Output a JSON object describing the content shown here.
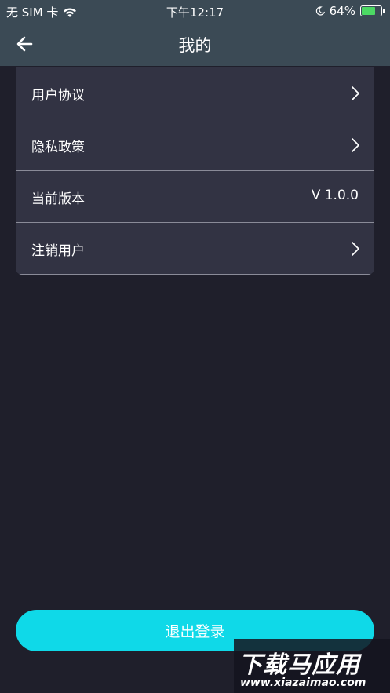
{
  "status_bar": {
    "carrier": "无 SIM 卡",
    "time": "下午12:17",
    "battery_percent": "64%",
    "battery_level": 0.64
  },
  "nav": {
    "title": "我的"
  },
  "settings": {
    "items": [
      {
        "label": "用户协议"
      },
      {
        "label": "隐私政策"
      },
      {
        "label": "当前版本",
        "value": "V 1.0.0"
      },
      {
        "label": "注销用户"
      }
    ]
  },
  "logout": {
    "label": "退出登录"
  },
  "watermark": {
    "title": "下载马应用",
    "url": "www.xiazaimao.com"
  },
  "colors": {
    "background": "#1f1f2b",
    "header": "#3b4a55",
    "card": "#323343",
    "accent": "#0fd9e8",
    "battery": "#4cd964"
  }
}
